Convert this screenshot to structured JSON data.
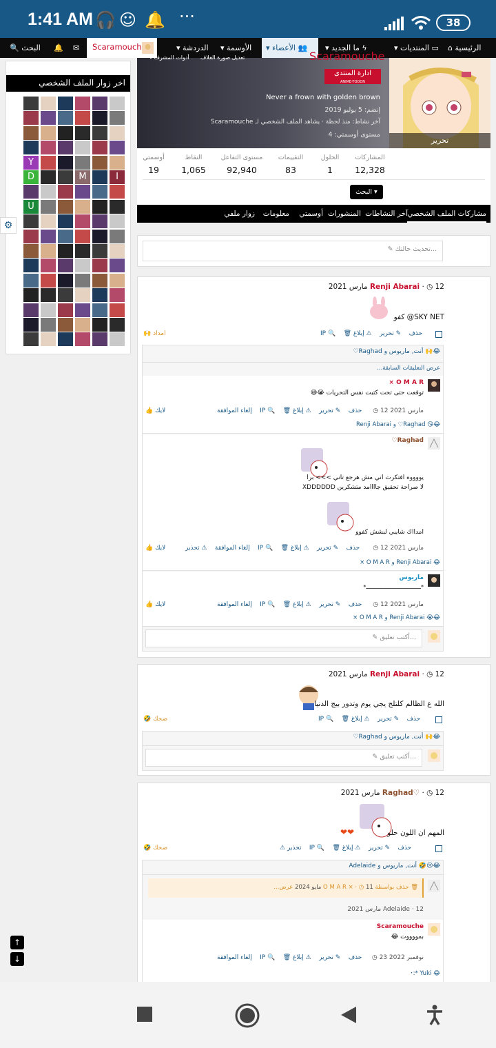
{
  "status": {
    "time": "1:41 AM",
    "battery": "38"
  },
  "nav": {
    "home": "الرئيسية",
    "forums": "المنتديات",
    "new": "ما الجديد",
    "members": "الأعضاء",
    "badges": "الأوسمة",
    "chat": "الدردشة",
    "user": "Scaramouche",
    "search": "البحث"
  },
  "sidebar": {
    "title": "اخر زوار الملف الشخصي",
    "letters": [
      "Y",
      "D",
      "M",
      "I",
      "U"
    ]
  },
  "profile": {
    "name": "Scaramouche",
    "cover_tools": "أدوات المشرف",
    "cover_edit": "تعديل صورة الغلاف",
    "banner": "ادارة المنتدى",
    "banner_sub": "ANIME-TOOON",
    "status": "Never a frown with golden brown",
    "joined": "إنضم: 5 يوليو 2019",
    "last_activity": "آخر نشاط: منذ لحظة · يشاهد الملف الشخصي لـ Scaramouche",
    "level": "مستوى أوسمتي: 4",
    "edit": "تحرير",
    "search_btn": "البحث",
    "stats": [
      {
        "label": "المشاركات",
        "value": "12,328"
      },
      {
        "label": "الحلول",
        "value": "1"
      },
      {
        "label": "التقييمات",
        "value": "83"
      },
      {
        "label": "مستوى التفاعل",
        "value": "92,940"
      },
      {
        "label": "النقاط",
        "value": "1,065"
      },
      {
        "label": "أوسمتي",
        "value": "19"
      }
    ],
    "tabs": [
      "مشاركات الملف الشخصي",
      "آخر النشاطات",
      "المنشورات",
      "أوسمتي",
      "معلومات",
      "زوار ملفي"
    ]
  },
  "status_input": {
    "placeholder": "تحديث حالتك..."
  },
  "actions": {
    "report": "إبلاغ",
    "edit": "تحرير",
    "delete": "حذف",
    "ip": "IP",
    "warn": "تحذير",
    "unlike": "إلغاء الموافقة",
    "like": "لايك"
  },
  "post1": {
    "author": "Renji Abarai",
    "date": "12 مارس 2021",
    "text": "SKY NET@ كفو",
    "reaction": "امداد",
    "reactors": "أنت, ماريوس و Raghad♡",
    "prev": "عرض التعليقات السابقة...",
    "comments": [
      {
        "author": "O M A R ×",
        "text": "توقعت حتى تحت كتبت نفس التحريات",
        "date": "12 مارس 2021",
        "reactors": "Raghad♡ و Renji Abarai"
      },
      {
        "author": "Raghad♡",
        "text": "يووووه افتكرت اني مش هرجع تاني >>> برا",
        "text2": "لا صراحة تحقيق جاااامد متشكرين XDDDDDD",
        "text3": "امدااك شايبي لبشش كفوو",
        "date": "12 مارس 2021",
        "reactors": "Renji Abarai و O M A R ×"
      },
      {
        "author": "ماريوس",
        "text": "*ــــــــــــــــــــــــــــــــــ*",
        "date": "12 مارس 2021",
        "reactors": "Renji Abarai و O M A R ×"
      }
    ],
    "write": "أكتب تعليق..."
  },
  "post2": {
    "author": "Renji Abarai",
    "date": "12 مارس 2021",
    "text": "الله ع الظالم كلتلج يجي يوم وتدور بيج الدنيا",
    "reaction": "ضحك",
    "reactors": "أنت, ماريوس و Raghad♡",
    "write": "أكتب تعليق..."
  },
  "post3": {
    "author": "Raghad♡",
    "date": "12 مارس 2021",
    "text": "المهم ان اللون حلو",
    "reaction": "ضحك",
    "reactors": "أنت, ماريوس و Adelaide",
    "deleted": "حذف بواسطة O M A R ×",
    "deleted_date": "11 مايو 2024",
    "show": "عرض...",
    "adelaide": "Adelaide · 12 مارس 2021",
    "c_author": "Scaramouche",
    "c_text": "بمووووت",
    "c_date": "23 نوفمبر 2022",
    "c_reactors": "Yuki *:･"
  }
}
